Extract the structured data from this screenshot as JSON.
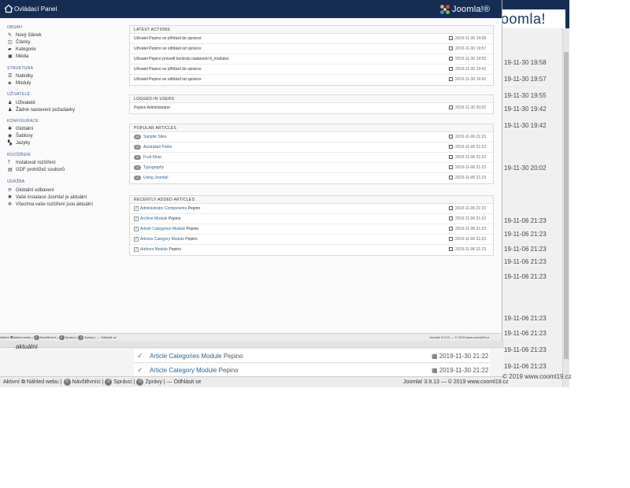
{
  "background": {
    "brand": "oomla!",
    "times": [
      "19-11-30 19:58",
      "19-11-30 19:57",
      "19-11-30 19:55",
      "19-11-30 19:42",
      "19-11-30 19:42",
      "19-11-30 20:02",
      "19-11-06 21:23",
      "19-11-06 21:23",
      "19-11-06 21:23",
      "19-11-06 21:23",
      "19-11-06 21:23",
      "19-11-06 21:23",
      "19-11-06 21:23",
      "19-11-06 21:23",
      "19-11-06 21:23"
    ],
    "copyright": "© 2019 www.cooml19.cz",
    "aktualni": "aktuální",
    "rows": [
      {
        "title": "Article Categories Module",
        "author": "Pepino",
        "date": "2019-11-30 21:22"
      },
      {
        "title": "Article Category Module",
        "author": "Pepino",
        "date": "2019-11-30 21:22"
      }
    ],
    "status": {
      "items": [
        {
          "label": "Aktivní",
          "icon": "view-site-icon"
        },
        {
          "label": "Náhled webu"
        },
        {
          "badge": "0",
          "label": "Návštěvníci"
        },
        {
          "badge": "0",
          "label": "Správci"
        },
        {
          "badge": "0",
          "label": "Zprávy"
        },
        {
          "label": "Odhlásit se"
        }
      ],
      "version": "Joomla! 3.9.13 — © 2019 www.cooml19.cz"
    }
  },
  "main": {
    "title": "Ovládací Panel",
    "logo_text": "Joomla!®",
    "sidebar": [
      {
        "heading": "OBSAH",
        "items": [
          {
            "icon": "pencil-icon",
            "label": "Nový článek"
          },
          {
            "icon": "stack-icon",
            "label": "Články"
          },
          {
            "icon": "folder-icon",
            "label": "Kategorie"
          },
          {
            "icon": "image-icon",
            "label": "Média"
          }
        ]
      },
      {
        "heading": "STRUKTURA",
        "items": [
          {
            "icon": "list-icon",
            "label": "Nabídky"
          },
          {
            "icon": "cube-icon",
            "label": "Moduly"
          }
        ]
      },
      {
        "heading": "UŽIVATELÉ",
        "items": [
          {
            "icon": "user-icon",
            "label": "Uživatelé"
          },
          {
            "icon": "users-icon",
            "label": "Žádné nastavení požadavky"
          }
        ]
      },
      {
        "heading": "KONFIGURACE",
        "items": [
          {
            "icon": "cog-icon",
            "label": "Globální"
          },
          {
            "icon": "eye-icon",
            "label": "Šablony"
          },
          {
            "icon": "comments-icon",
            "label": "Jazyky"
          }
        ]
      },
      {
        "heading": "ROZŠÍŘENÍ",
        "items": [
          {
            "icon": "upload-icon",
            "label": "Instalovat rozšíření"
          },
          {
            "icon": "database-icon",
            "label": "GDF prohlížeč souborů"
          }
        ]
      },
      {
        "heading": "ÚDRŽBA",
        "items": [
          {
            "icon": "refresh-icon",
            "label": "Globální odbavení"
          },
          {
            "icon": "wrench-icon",
            "label": "Vaše instalace Joomla! je aktuální"
          },
          {
            "icon": "puzzle-icon",
            "label": "Všechna vaše rozšíření jsou aktuální"
          }
        ]
      }
    ],
    "panels": {
      "latest_actions": {
        "title": "LATEST ACTIONS",
        "rows": [
          {
            "text": "Uživatel Pepino se přihlásil do správce",
            "date": "2019-11-30 19:58"
          },
          {
            "text": "Uživatel Pepino se odhlásil od správce",
            "date": "2019-11-30 19:57"
          },
          {
            "text": "Uživatel Pepino provedl kontrolu nastavení tt_modules",
            "date": "2019-11-30 19:55"
          },
          {
            "text": "Uživatel Pepino se přihlásil do správce",
            "date": "2019-11-30 19:42"
          },
          {
            "text": "Uživatel Pepino se odhlásil od správce",
            "date": "2019-11-30 19:42"
          }
        ]
      },
      "logged_in": {
        "title": "LOGGED-IN USERS",
        "rows": [
          {
            "text": "Pepino Administrator",
            "date": "2019-11-30 20:02"
          }
        ]
      },
      "popular": {
        "title": "POPULAR ARTICLES",
        "rows": [
          {
            "hits": "43",
            "text": "Sample Sites",
            "date": "2019-11-06 21:23"
          },
          {
            "hits": "14",
            "text": "Australian Parks",
            "date": "2019-11-06 21:23"
          },
          {
            "hits": "8",
            "text": "Fruit Shop",
            "date": "2019-11-06 21:23"
          },
          {
            "hits": "5",
            "text": "Typography",
            "date": "2019-11-06 21:23"
          },
          {
            "hits": "5",
            "text": "Using Joomla!",
            "date": "2019-11-06 21:23"
          }
        ]
      },
      "recent": {
        "title": "RECENTLY ADDED ARTICLES",
        "rows": [
          {
            "text": "Administrator Components",
            "author": "Pepino",
            "date": "2019-11-06 21:23"
          },
          {
            "text": "Archive Module",
            "author": "Pepino",
            "date": "2019-11-06 21:23"
          },
          {
            "text": "Article Categories Module",
            "author": "Pepino",
            "date": "2019-11-06 21:23"
          },
          {
            "text": "Articles Category Module",
            "author": "Pepino",
            "date": "2019-11-06 21:23"
          },
          {
            "text": "Authors Module",
            "author": "Pepino",
            "date": "2019-11-06 21:23"
          }
        ]
      }
    },
    "status": {
      "items": [
        {
          "label": "Aktivní"
        },
        {
          "label": "Náhled webu"
        },
        {
          "badge": "0",
          "label": "Návštěvníci"
        },
        {
          "badge": "0",
          "label": "Správci"
        },
        {
          "badge": "0",
          "label": "Zprávy"
        },
        {
          "label": "Odhlásit se"
        }
      ],
      "version": "Joomla! 3.9.13 — © 2019 www.cooml19.cz"
    },
    "colors": {
      "header": "#152d53",
      "link": "#2a6496",
      "heading": "#3b5998",
      "success": "#468847"
    }
  }
}
